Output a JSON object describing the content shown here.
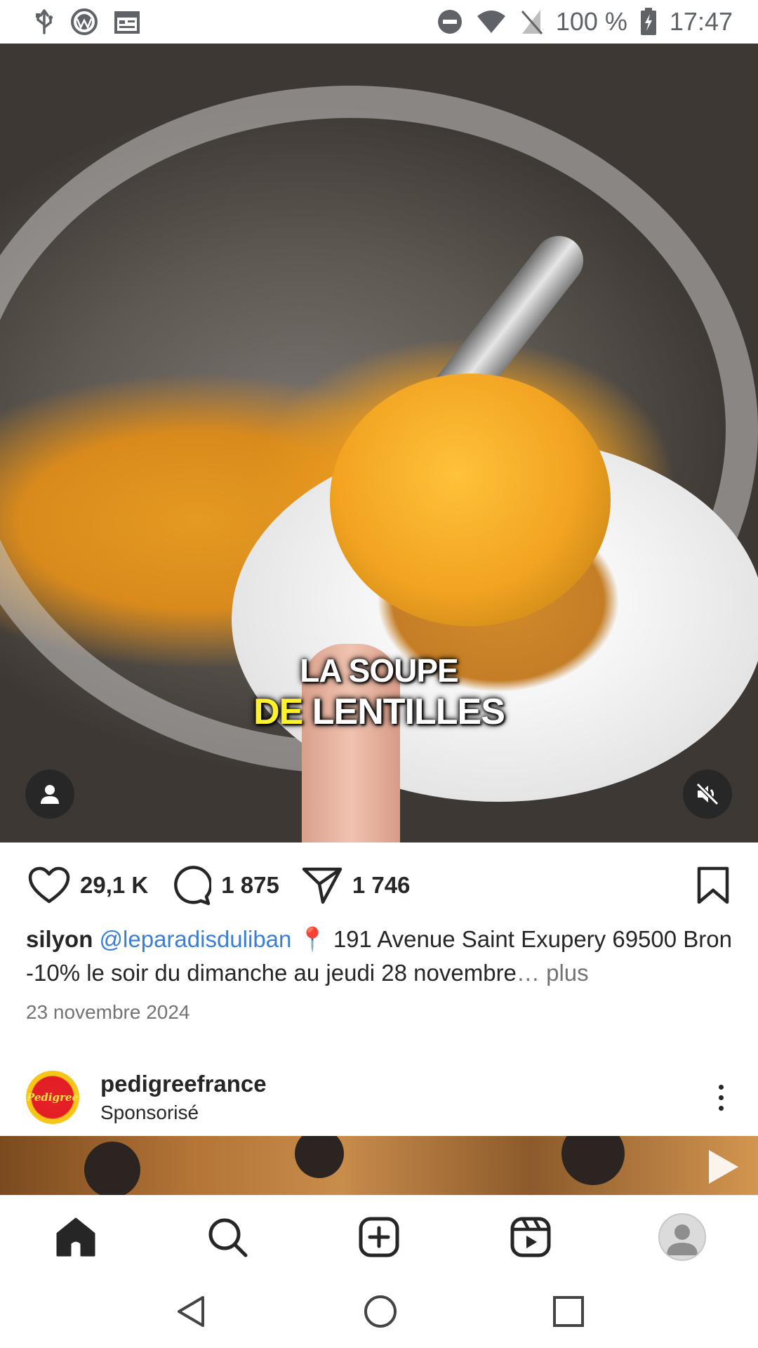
{
  "status_bar": {
    "battery": "100 %",
    "time": "17:47",
    "left_icons": [
      "usb-icon",
      "browser-icon",
      "calendar-icon"
    ],
    "right_icons": [
      "do-not-disturb-icon",
      "wifi-icon",
      "no-sim-icon",
      "battery-charging-icon"
    ]
  },
  "post": {
    "overlay_line1": "LA SOUPE",
    "overlay_line2_highlight": "DE",
    "overlay_line2_rest": "LENTILLES",
    "likes": "29,1 K",
    "comments": "1 875",
    "shares": "1 746",
    "username": "silyon",
    "mention": "@leparadisduliban",
    "pin_emoji": "📍",
    "caption_text": "191 Avenue Saint Exupery 69500 Bron -10% le soir du dimanche au jeudi 28 novembre",
    "more_ellipsis": "…",
    "more_label": "plus",
    "date": "23 novembre 2024"
  },
  "sponsored": {
    "account_name": "pedigreefrance",
    "label": "Sponsorisé",
    "avatar_text": "Pedigree"
  },
  "colors": {
    "text": "#262626",
    "mention": "#3b7ed6",
    "muted": "#737373",
    "overlay_highlight": "#fff22b"
  },
  "bottom_nav": [
    "home-icon",
    "search-icon",
    "create-icon",
    "reels-icon",
    "profile-avatar"
  ],
  "system_nav": [
    "back-icon",
    "home-circle-icon",
    "recents-icon"
  ]
}
